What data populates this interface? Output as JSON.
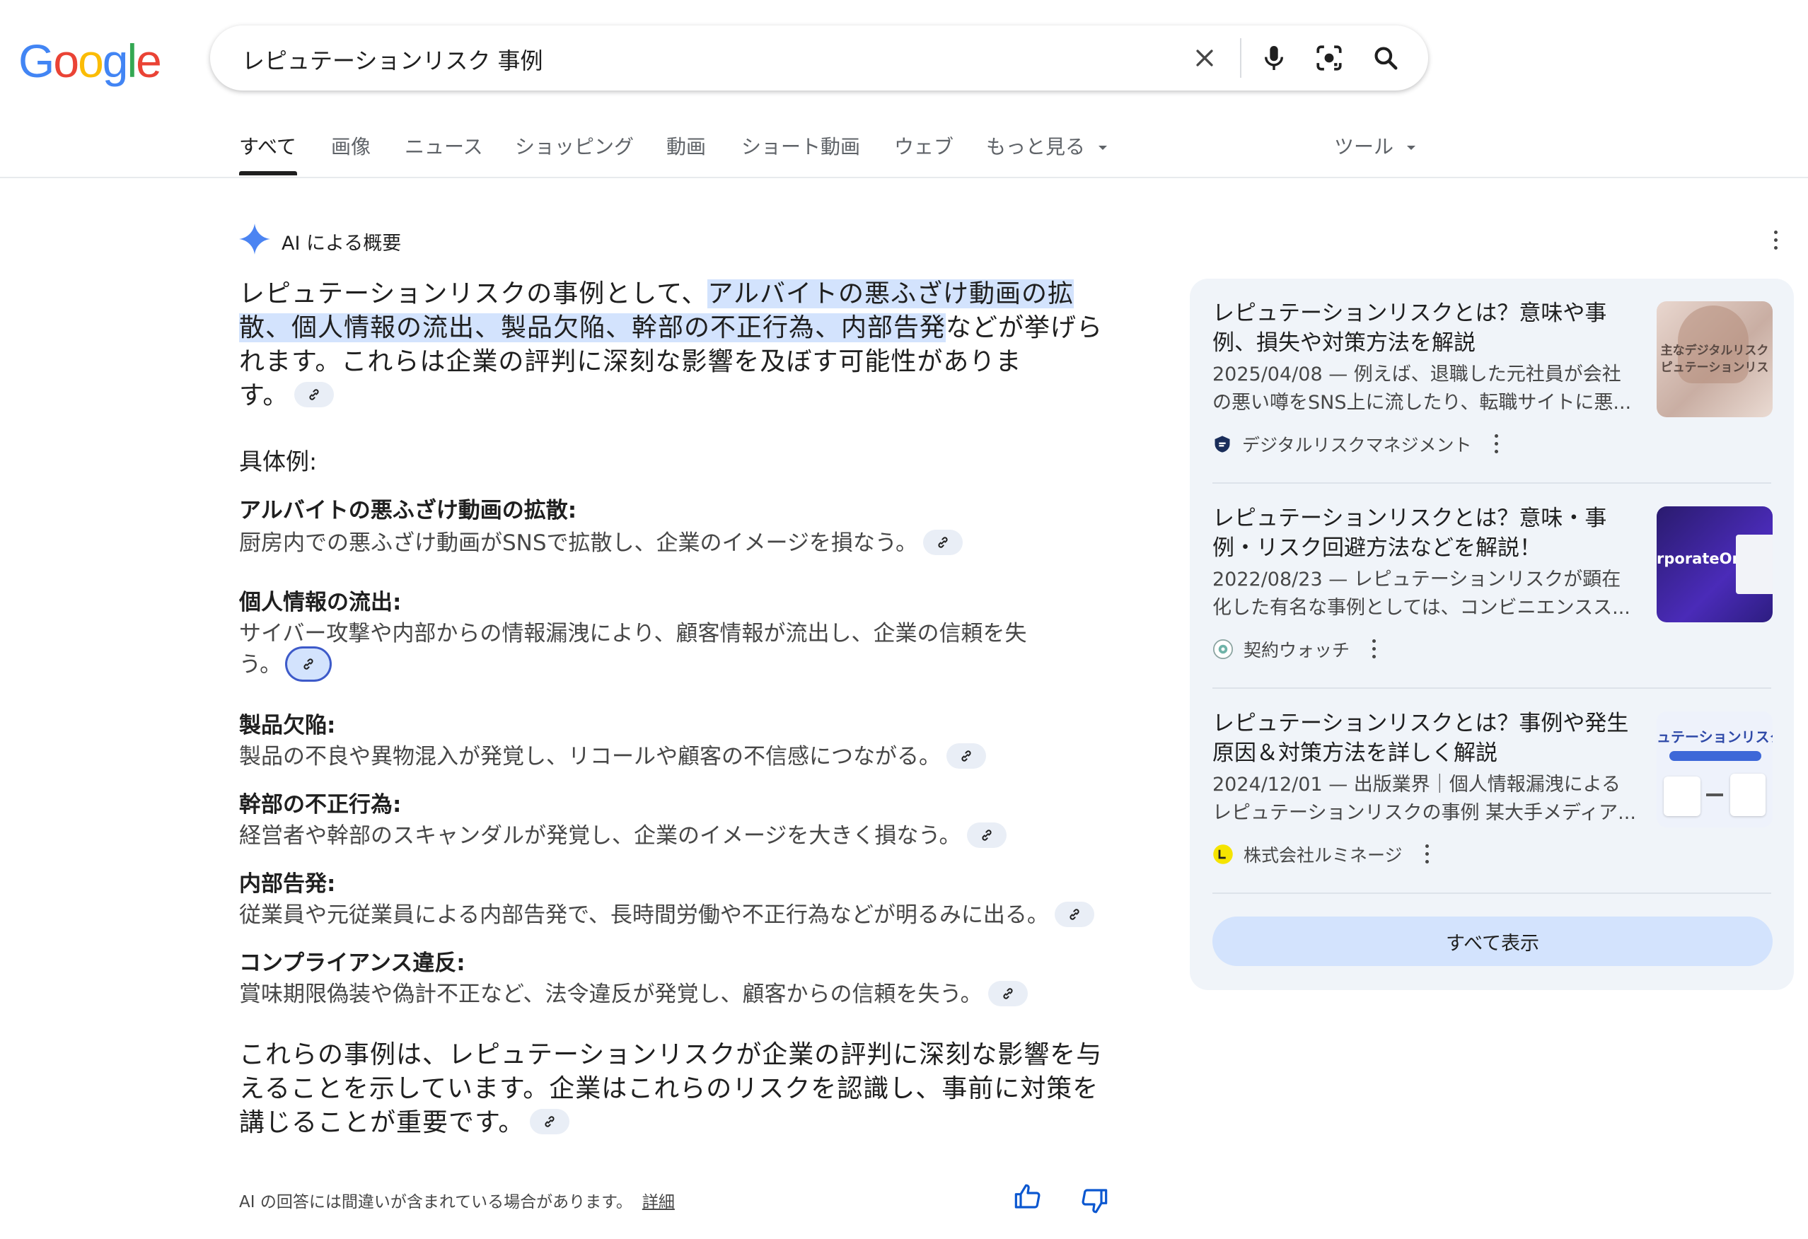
{
  "logo": {
    "letters": [
      "G",
      "o",
      "o",
      "g",
      "l",
      "e"
    ],
    "colors": [
      "#4285F4",
      "#EA4335",
      "#FBBC05",
      "#4285F4",
      "#34A853",
      "#EA4335"
    ]
  },
  "search": {
    "query": "レピュテーションリスク 事例"
  },
  "tabs": [
    "すべて",
    "画像",
    "ニュース",
    "ショッピング",
    "動画",
    "ショート動画",
    "ウェブ",
    "もっと見る"
  ],
  "tools_label": "ツール",
  "ai": {
    "label": "AI による概要",
    "intro_before": "レピュテーションリスクの事例として、",
    "intro_hl_1": "アルバイトの悪ふざけ動画の拡",
    "intro_hl_2": "散、個人情報の流出、製品欠陥、幹部の不正行為、内部告発",
    "intro_after_1": "などが挙げら",
    "intro_line3": "れます。これらは企業の評判に深刻な影響を及ぼす可能性がありま",
    "intro_line4": "す。",
    "examples_heading": "具体例:",
    "examples": [
      {
        "title": "アルバイトの悪ふざけ動画の拡散:",
        "desc1": "厨房内での悪ふざけ動画がSNSで拡散し、企業のイメージを損なう。",
        "desc2": ""
      },
      {
        "title": "個人情報の流出:",
        "desc1": "サイバー攻撃や内部からの情報漏洩により、顧客情報が流出し、企業の信頼を失",
        "desc2": "う。"
      },
      {
        "title": "製品欠陥:",
        "desc1": "製品の不良や異物混入が発覚し、リコールや顧客の不信感につながる。",
        "desc2": ""
      },
      {
        "title": "幹部の不正行為:",
        "desc1": "経営者や幹部のスキャンダルが発覚し、企業のイメージを大きく損なう。",
        "desc2": ""
      },
      {
        "title": "内部告発:",
        "desc1": "従業員や元従業員による内部告発で、長時間労働や不正行為などが明るみに出る。",
        "desc2": ""
      },
      {
        "title": "コンプライアンス違反:",
        "desc1": "賞味期限偽装や偽計不正など、法令違反が発覚し、顧客からの信頼を失う。",
        "desc2": ""
      }
    ],
    "conclusion_1": "これらの事例は、レピュテーションリスクが企業の評判に深刻な影響を与",
    "conclusion_2": "えることを示しています。企業はこれらのリスクを認識し、事前に対策を",
    "conclusion_3": "講じることが重要です。",
    "disclaimer": "AI の回答には間違いが含まれている場合があります。",
    "disclaimer_link": "詳細"
  },
  "sources": [
    {
      "title": "レピュテーションリスクとは？意味や事例、損失や対策方法を解説",
      "snippet": "2025/04/08 — 例えば、退職した元社員が会社の悪い噂をSNS上に流したり、転職サイトに悪...",
      "source": "デジタルリスクマネジメント",
      "thumb_text": "主なデジタルリスク ピュテーションリス"
    },
    {
      "title": "レピュテーションリスクとは？意味・事例・リスク回避方法などを解説！",
      "snippet": "2022/08/23 — レピュテーションリスクが顕在化した有名な事例としては、コンビニエンスス...",
      "source": "契約ウォッチ",
      "thumb_text": "rporateOn"
    },
    {
      "title": "レピュテーションリスクとは？事例や発生原因＆対策方法を詳しく解説",
      "snippet": "2024/12/01 — 出版業界｜個人情報漏洩によるレピュテーションリスクの事例 某大手メディア...",
      "source": "株式会社ルミネージ",
      "thumb_text": "ュテーションリスク"
    }
  ],
  "show_all": "すべて表示",
  "colors": {
    "accent": "#0b57d0",
    "highlight": "#d3e3fd",
    "panel": "#f0f4f9"
  }
}
